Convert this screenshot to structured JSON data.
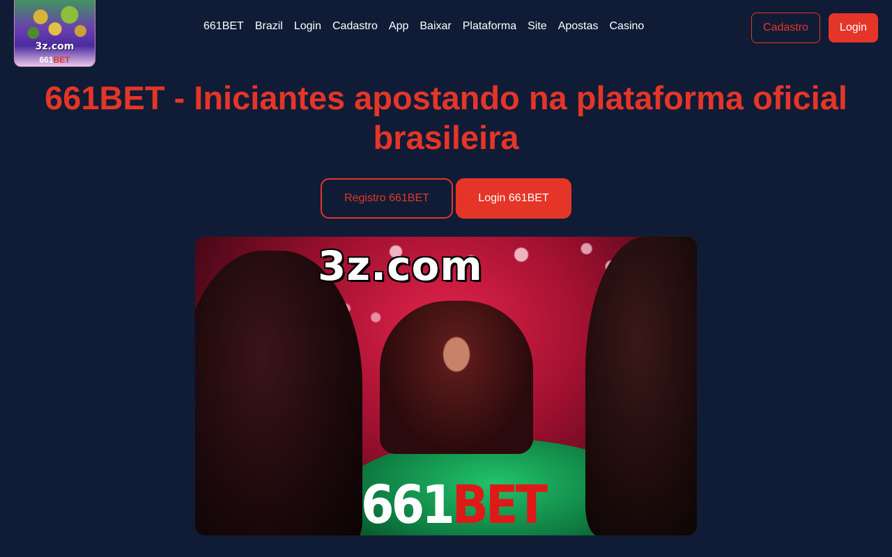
{
  "header": {
    "logo": {
      "line1": "3z.com",
      "line2_prefix": "661",
      "line2_suffix": "BET"
    },
    "nav": [
      {
        "label": "661BET"
      },
      {
        "label": "Brazil"
      },
      {
        "label": "Login"
      },
      {
        "label": "Cadastro"
      },
      {
        "label": "App"
      },
      {
        "label": "Baixar"
      },
      {
        "label": "Plataforma"
      },
      {
        "label": "Site"
      },
      {
        "label": "Apostas"
      },
      {
        "label": "Casino"
      }
    ],
    "cadastro_label": "Cadastro",
    "login_label": "Login"
  },
  "hero": {
    "title": "661BET - Iniciantes apostando na plataforma oficial brasileira",
    "register_label": "Registro 661BET",
    "login_label": "Login 661BET",
    "image": {
      "watermark_top": "3z.com",
      "watermark_bottom_prefix": "661",
      "watermark_bottom_suffix": "BET"
    }
  },
  "colors": {
    "background": "#101c36",
    "accent": "#e53528",
    "text": "#ffffff"
  }
}
